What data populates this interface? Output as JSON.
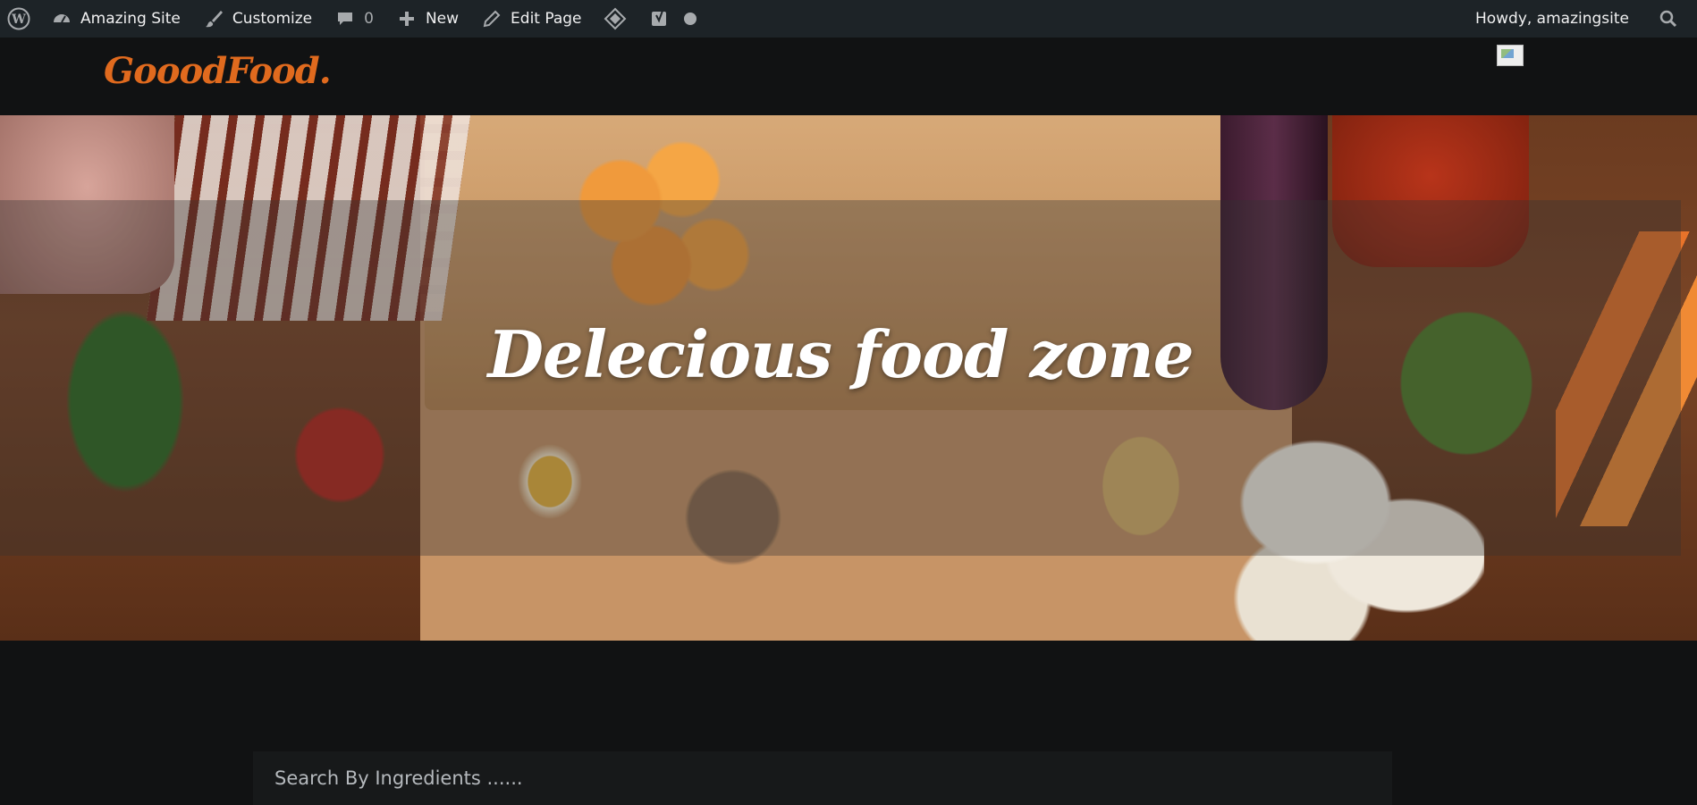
{
  "admin_bar": {
    "wp_logo_icon": "wordpress-icon",
    "site_name": "Amazing Site",
    "customize": "Customize",
    "comments_count": "0",
    "new": "New",
    "edit_page": "Edit Page",
    "howdy": "Howdy, amazingsite"
  },
  "header": {
    "logo": "GooodFood."
  },
  "hero": {
    "title": "Delecious food zone"
  },
  "search": {
    "placeholder": "Search By Ingredients ......"
  },
  "colors": {
    "admin_bar_bg": "#1d2327",
    "page_bg": "#111213",
    "logo_accent": "#e06a1e"
  }
}
